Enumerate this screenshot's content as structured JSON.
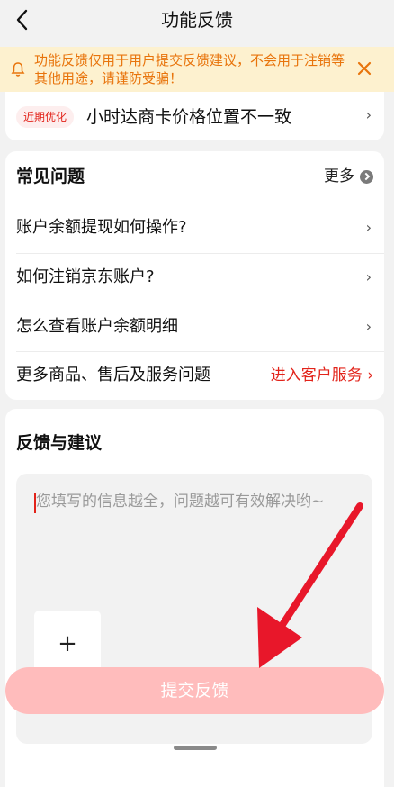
{
  "nav": {
    "title": "功能反馈"
  },
  "notice": {
    "text": "功能反馈仅用于用户提交反馈建议，不会用于注销等其他用途，请谨防受骗！"
  },
  "recent": {
    "tag": "近期优化",
    "text": "小时达商卡价格位置不一致"
  },
  "faq": {
    "title": "常见问题",
    "more_label": "更多",
    "items": [
      "账户余额提现如何操作?",
      "如何注销京东账户?",
      "怎么查看账户余额明细",
      "更多商品、售后及服务问题"
    ],
    "cs_link": "进入客户服务"
  },
  "feedback": {
    "title": "反馈与建议",
    "placeholder": "您填写的信息越全，问题越可有效解决哟~",
    "upload_symbol": "+"
  },
  "submit_label": "提交反馈",
  "colors": {
    "accent": "#e2231a",
    "notice_text": "#e8740c",
    "notice_bg": "#fdf1cf",
    "submit_bg": "#ffbcbc"
  }
}
